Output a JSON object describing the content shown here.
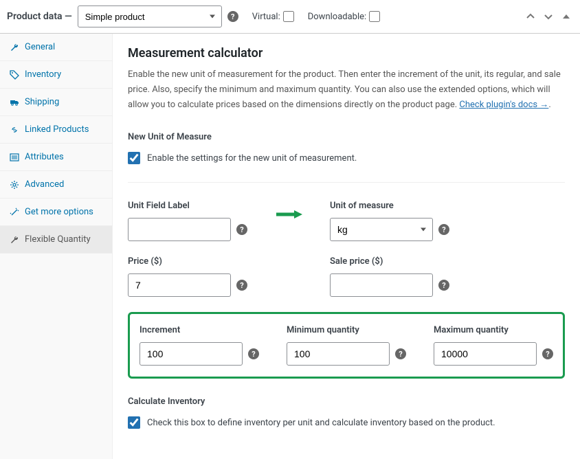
{
  "header": {
    "title": "Product data —",
    "product_type": "Simple product",
    "virtual_label": "Virtual:",
    "downloadable_label": "Downloadable:"
  },
  "sidebar": {
    "items": [
      {
        "label": "General",
        "icon": "wrench-icon"
      },
      {
        "label": "Inventory",
        "icon": "tag-icon"
      },
      {
        "label": "Shipping",
        "icon": "truck-icon"
      },
      {
        "label": "Linked Products",
        "icon": "link-icon"
      },
      {
        "label": "Attributes",
        "icon": "list-icon"
      },
      {
        "label": "Advanced",
        "icon": "gear-icon"
      },
      {
        "label": "Get more options",
        "icon": "wand-icon"
      },
      {
        "label": "Flexible Quantity",
        "icon": "wrench-icon"
      }
    ]
  },
  "content": {
    "title": "Measurement calculator",
    "description": "Enable the new unit of measurement for the product. Then enter the increment of the unit, its regular, and sale price. Also, specify the minimum and maximum quantity. You can also use the extended options, which will allow you to calculate prices based on the dimensions directly on the product page. ",
    "docs_link": "Check plugin's docs →",
    "new_unit_heading": "New Unit of Measure",
    "enable_label": "Enable the settings for the new unit of measurement.",
    "unit_field_label": "Unit Field Label",
    "unit_field_value": "",
    "unit_of_measure_label": "Unit of measure",
    "unit_of_measure_value": "kg",
    "price_label": "Price ($)",
    "price_value": "7",
    "sale_price_label": "Sale price ($)",
    "sale_price_value": "",
    "increment_label": "Increment",
    "increment_value": "100",
    "min_qty_label": "Minimum quantity",
    "min_qty_value": "100",
    "max_qty_label": "Maximum quantity",
    "max_qty_value": "10000",
    "calculate_inventory_heading": "Calculate Inventory",
    "calculate_inventory_label": "Check this box to define inventory per unit and calculate inventory based on the product."
  }
}
